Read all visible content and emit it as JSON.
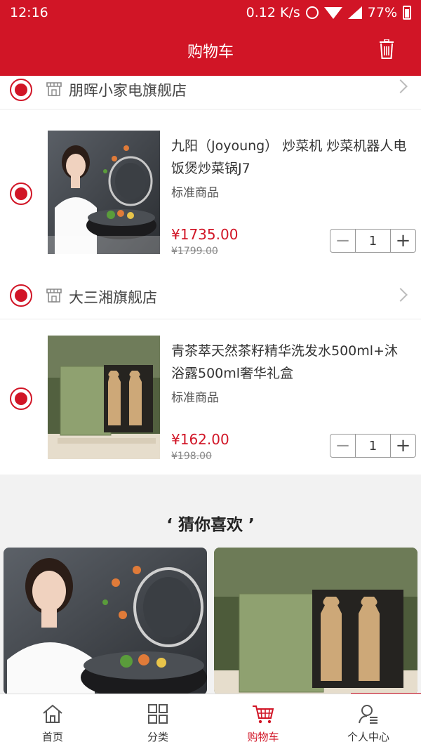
{
  "status_bar": {
    "time": "12:16",
    "net_speed": "0.12 K/s",
    "battery": "77%"
  },
  "header": {
    "title": "购物车"
  },
  "stores": [
    {
      "name": "朋晖小家电旗舰店",
      "items": [
        {
          "title": "九阳（Joyoung） 炒菜机 炒菜机器人电饭煲炒菜锅J7",
          "spec": "标准商品",
          "price": "¥1735.00",
          "old_price": "¥1799.00",
          "quantity": "1"
        }
      ]
    },
    {
      "name": "大三湘旗舰店",
      "items": [
        {
          "title": "青茶萃天然茶籽精华洗发水500ml+沐浴露500ml奢华礼盒",
          "spec": "标准商品",
          "price": "¥162.00",
          "old_price": "¥198.00",
          "quantity": "1"
        }
      ]
    }
  ],
  "stepper": {
    "minus": "−",
    "plus": "+"
  },
  "recommend": {
    "title": "‘ 猜你喜欢 ’"
  },
  "tabbar": [
    {
      "label": "首页",
      "icon": "home-icon"
    },
    {
      "label": "分类",
      "icon": "grid-icon"
    },
    {
      "label": "购物车",
      "icon": "cart-icon",
      "active": true
    },
    {
      "label": "个人中心",
      "icon": "user-icon"
    }
  ],
  "colors": {
    "primary": "#d11526",
    "background": "#f2f2f2"
  }
}
